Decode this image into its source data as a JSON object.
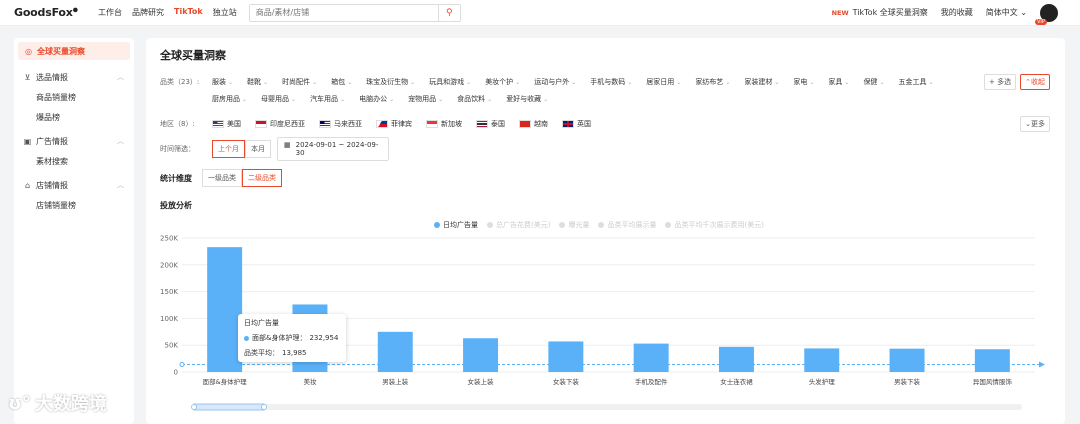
{
  "brand": {
    "name": "GoodsFox",
    "accent": "#e8492a",
    "bar_color": "#5bb1f8"
  },
  "topnav": [
    "工作台",
    "品牌研究",
    "TikTok",
    "独立站"
  ],
  "search": {
    "placeholder": "商品/素材/店铺"
  },
  "topright": {
    "new_badge": "NEW",
    "insight": "TikTok 全球买量洞察",
    "favorites": "我的收藏",
    "language": "简体中文",
    "vip": "VIP"
  },
  "sidebar": {
    "active": "全球买量洞察",
    "groups": [
      {
        "title": "选品情报",
        "items": [
          "商品销量榜",
          "爆品榜"
        ]
      },
      {
        "title": "广告情报",
        "items": [
          "素材搜索"
        ]
      },
      {
        "title": "店铺情报",
        "items": [
          "店铺销量榜"
        ]
      }
    ]
  },
  "main": {
    "title": "全球买量洞察",
    "category_label": "品类（23）:",
    "categories_row1": [
      "服装",
      "鞋靴",
      "时尚配件",
      "箱包",
      "珠宝及衍生物",
      "玩具和游戏",
      "美妆个护",
      "运动与户外",
      "手机与数码",
      "居家日用",
      "家纺布艺",
      "家装建材",
      "家电",
      "家具",
      "保健",
      "五金工具"
    ],
    "categories_row2": [
      "厨房用品",
      "母婴用品",
      "汽车用品",
      "电脑办公",
      "宠物用品",
      "食品饮料",
      "爱好与收藏"
    ],
    "multi": "多选",
    "collapse": "收起",
    "region_label": "地区（8）:",
    "regions": [
      {
        "name": "美国",
        "flag": "us"
      },
      {
        "name": "印度尼西亚",
        "flag": "id"
      },
      {
        "name": "马来西亚",
        "flag": "my"
      },
      {
        "name": "菲律宾",
        "flag": "ph"
      },
      {
        "name": "新加坡",
        "flag": "sg"
      },
      {
        "name": "泰国",
        "flag": "th"
      },
      {
        "name": "越南",
        "flag": "vn"
      },
      {
        "name": "英国",
        "flag": "gb"
      }
    ],
    "more": "更多",
    "time_label": "时间筛选：",
    "time_options": [
      "上个月",
      "本月"
    ],
    "date_range": "2024-09-01 ~ 2024-09-30",
    "dimension_label": "统计维度",
    "dimension_options": [
      "一级品类",
      "二级品类"
    ],
    "analysis_title": "投放分析",
    "legend": [
      "日均广告量",
      "总广告花费(美元)",
      "曝光量",
      "品类平均展示量",
      "品类平均千次展示费用(美元)"
    ],
    "tooltip": {
      "title": "日均广告量",
      "series_label": "面部&身体护理：",
      "series_value": "232,954",
      "avg_label": "品类平均：",
      "avg_value": "13,985"
    }
  },
  "chart_data": {
    "type": "bar",
    "categories": [
      "面部&身体护理",
      "美妆",
      "男装上装",
      "女装上装",
      "女装下装",
      "手机及配件",
      "女士连衣裙",
      "头发护理",
      "男装下装",
      "异国风情服饰"
    ],
    "series": [
      {
        "name": "日均广告量",
        "values": [
          232954,
          126000,
          75000,
          63000,
          57000,
          53000,
          47000,
          44000,
          43500,
          42500
        ]
      }
    ],
    "average": 13985,
    "y_ticks": [
      "0",
      "50K",
      "100K",
      "150K",
      "200K",
      "250K"
    ],
    "ylim": [
      0,
      250000
    ],
    "grid": true
  },
  "watermark": "大数跨境"
}
